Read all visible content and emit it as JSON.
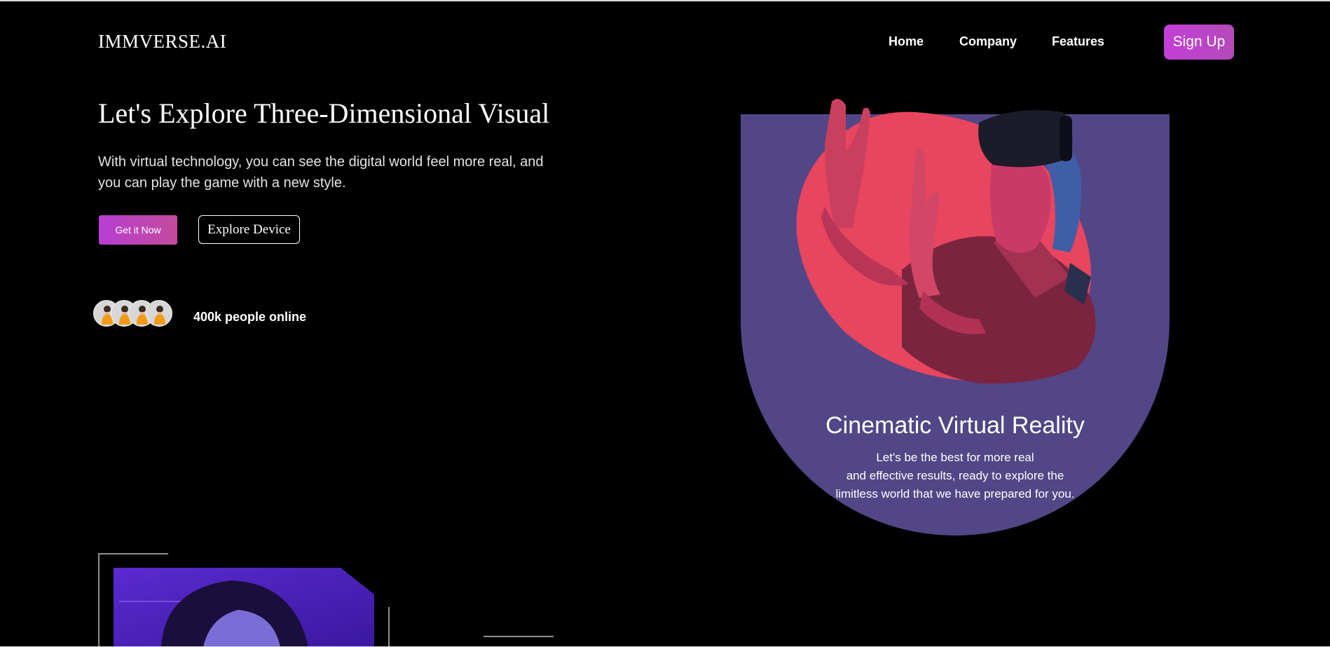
{
  "brand": {
    "logo": "IMMVERSE.AI"
  },
  "nav": {
    "items": [
      {
        "label": "Home"
      },
      {
        "label": "Company"
      },
      {
        "label": "Features"
      }
    ],
    "signup_label": "Sign Up"
  },
  "hero": {
    "title": "Let's Explore Three-Dimensional Visual",
    "subtitle": "With virtual technology, you can see the digital world feel more real, and you can play the game with a new style.",
    "primary_button": "Get it Now",
    "secondary_button": "Explore Device",
    "online_text": "400k people online",
    "avatar_icons": [
      "person-avatar-icon",
      "person-avatar-icon",
      "person-avatar-icon",
      "person-avatar-icon"
    ]
  },
  "feature_card": {
    "title": "Cinematic Virtual Reality",
    "description_lines": [
      "Let's be the best for more real",
      "and effective results, ready to explore the",
      "limitless world that we have prepared for you."
    ]
  },
  "colors": {
    "background": "#000000",
    "accent_gradient_start": "#c23fd8",
    "accent_gradient_end": "#b44ab8",
    "card_purple": "#524686",
    "blob_pink": "#e8455f"
  }
}
